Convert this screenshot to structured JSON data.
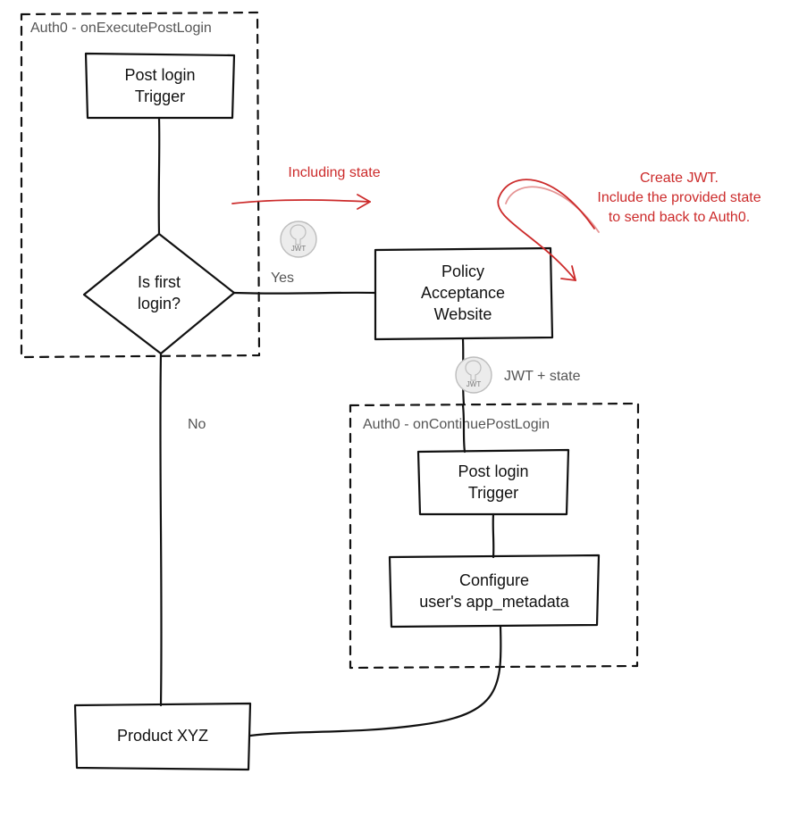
{
  "diagram": {
    "group1_title": "Auth0 - onExecutePostLogin",
    "node_postlogin1_l1": "Post login",
    "node_postlogin1_l2": "Trigger",
    "decision_l1": "Is first",
    "decision_l2": "login?",
    "edge_yes": "Yes",
    "edge_no": "No",
    "anno_including_state": "Including state",
    "node_policy_l1": "Policy",
    "node_policy_l2": "Acceptance",
    "node_policy_l3": "Website",
    "red_note_l1": "Create JWT.",
    "red_note_l2": "Include the provided state",
    "red_note_l3": "to send back to Auth0.",
    "anno_jwt_state": "JWT + state",
    "group2_title": "Auth0 - onContinuePostLogin",
    "node_postlogin2_l1": "Post login",
    "node_postlogin2_l2": "Trigger",
    "node_config_l1": "Configure",
    "node_config_l2": "user's app_metadata",
    "node_product": "Product XYZ",
    "jwt_badge": "JWT"
  }
}
